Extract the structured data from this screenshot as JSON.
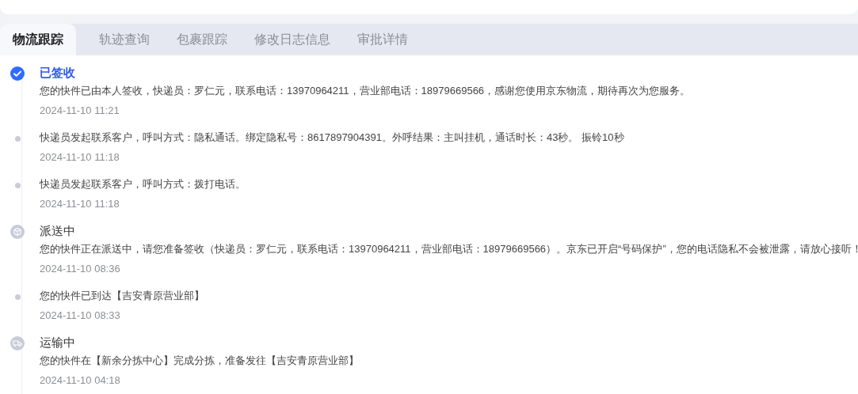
{
  "tabs": [
    {
      "label": "物流跟踪",
      "selected": true
    },
    {
      "label": "轨迹查询",
      "selected": false
    },
    {
      "label": "包裹跟踪",
      "selected": false
    },
    {
      "label": "修改日志信息",
      "selected": false
    },
    {
      "label": "审批详情",
      "selected": false
    }
  ],
  "timeline": [
    {
      "kind": "signed",
      "current": true,
      "title": "已签收",
      "text": "您的快件已由本人签收，快递员：罗仁元，联系电话：13970964211，营业部电话：18979669566，感谢您使用京东物流，期待再次为您服务。",
      "time": "2024-11-10 11:21"
    },
    {
      "kind": "dot",
      "text": "快递员发起联系客户，呼叫方式：隐私通话。绑定隐私号：8617897904391。外呼结果：主叫挂机，通话时长：43秒。 振铃10秒",
      "time": "2024-11-10 11:18"
    },
    {
      "kind": "dot",
      "text": "快递员发起联系客户，呼叫方式：拨打电话。",
      "time": "2024-11-10 11:18"
    },
    {
      "kind": "delivering",
      "current": false,
      "title": "派送中",
      "text": "您的快件正在派送中，请您准备签收（快递员：罗仁元，联系电话：13970964211，营业部电话：18979669566）。京东已开启“号码保护”，您的电话隐私不会被泄露，请放心接听！",
      "time": "2024-11-10 08:36"
    },
    {
      "kind": "dot",
      "text": "您的快件已到达【吉安青原营业部】",
      "time": "2024-11-10 08:33"
    },
    {
      "kind": "transit",
      "current": false,
      "title": "运输中",
      "text": "您的快件在【新余分拣中心】完成分拣，准备发往【吉安青原营业部】",
      "time": "2024-11-10 04:18"
    }
  ]
}
